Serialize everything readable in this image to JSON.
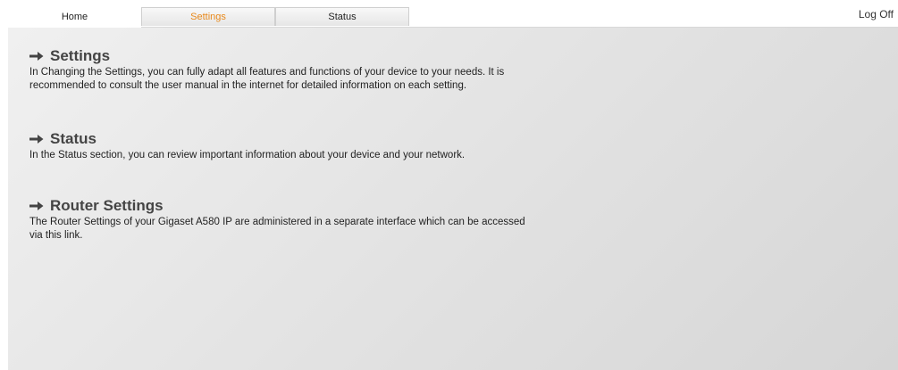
{
  "tabs": [
    {
      "label": "Home"
    },
    {
      "label": "Settings"
    },
    {
      "label": "Status"
    }
  ],
  "header": {
    "logoff_label": "Log Off"
  },
  "sections": [
    {
      "heading": "Settings",
      "body": "In Changing the Settings, you can fully adapt all features and functions of your device to your needs. It is recommended to consult the user manual in the internet for detailed information on each setting."
    },
    {
      "heading": "Status",
      "body": "In the Status section, you can review important information about your device and your network."
    },
    {
      "heading": "Router Settings",
      "body": "The Router Settings of your Gigaset A580 IP are administered in a separate interface which can be accessed via this link."
    }
  ],
  "colors": {
    "accent": "#e8891b",
    "heading": "#444444",
    "content_bg": "#e4e4e4"
  },
  "icons": {
    "section_arrow": "right-arrow-icon"
  }
}
